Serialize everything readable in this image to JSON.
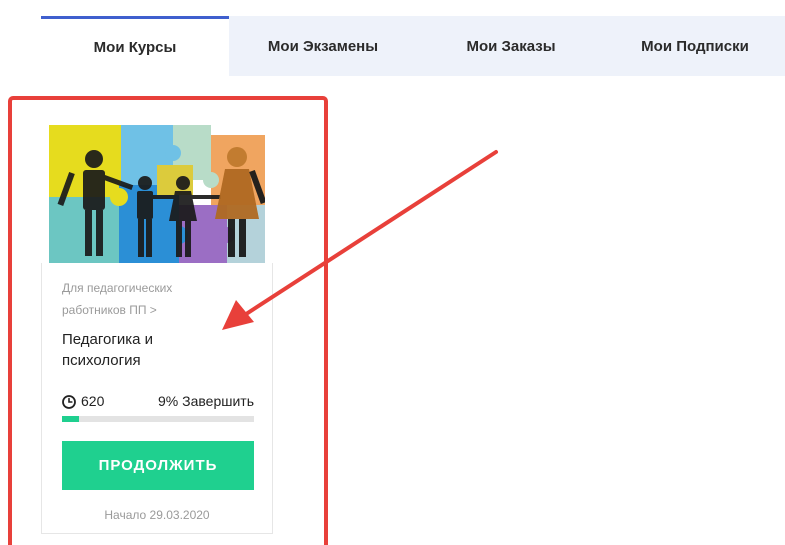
{
  "tabs": [
    {
      "label": "Мои Курсы",
      "active": true
    },
    {
      "label": "Мои Экзамены",
      "active": false
    },
    {
      "label": "Мои Заказы",
      "active": false
    },
    {
      "label": "Мои Подписки",
      "active": false
    }
  ],
  "course": {
    "category": "Для педагогических работников ПП >",
    "title": "Педагогика и психология",
    "hours": "620",
    "progress_text": "9% Завершить",
    "progress_percent": 9,
    "button_label": "ПРОДОЛЖИТЬ",
    "start_date": "Начало 29.03.2020",
    "image_icon": "puzzle-family-image"
  },
  "icons": {
    "clock": "clock-icon"
  },
  "colors": {
    "active_tab_border": "#3f5fce",
    "tabs_background": "#eef2fa",
    "accent_green": "#1fd08f",
    "highlight_red": "#e8403a"
  }
}
